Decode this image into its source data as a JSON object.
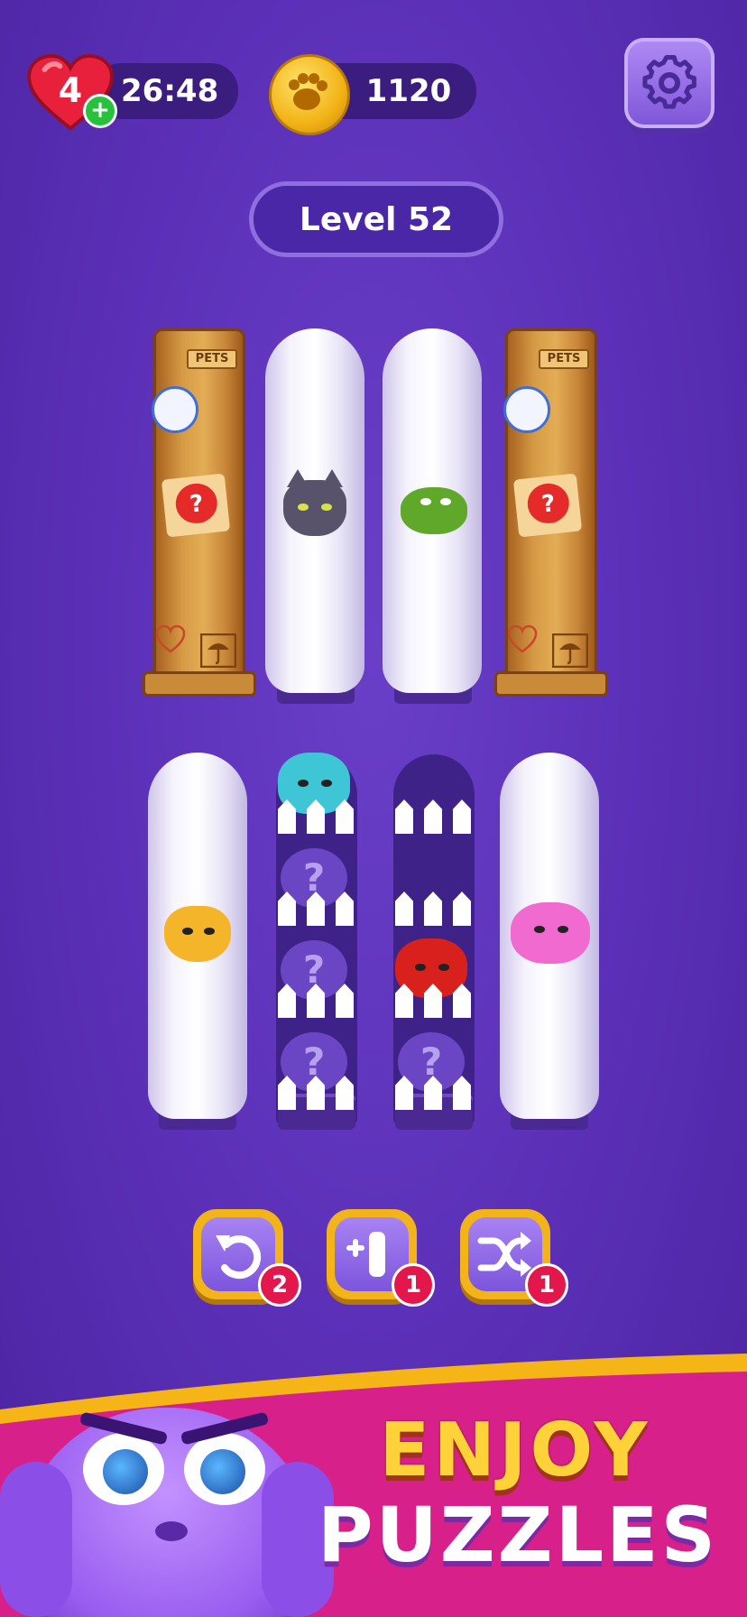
{
  "header": {
    "lives": "4",
    "lives_plus": "+",
    "timer": "26:48",
    "coins": "1120",
    "settings_icon": "gear-icon",
    "level_label": "Level 52"
  },
  "board": {
    "crate_tag": "PETS",
    "mystery_mark": "?"
  },
  "boosters": [
    {
      "name": "undo",
      "icon": "undo-icon",
      "count": "2"
    },
    {
      "name": "add-tube",
      "icon": "add-tube-icon",
      "count": "1"
    },
    {
      "name": "shuffle",
      "icon": "shuffle-icon",
      "count": "1"
    }
  ],
  "banner": {
    "line1": "ENJOY",
    "line2": "PUZZLES"
  },
  "colors": {
    "background": "#5a2fb6",
    "banner_pink": "#d8208a",
    "banner_yellow": "#f6b516",
    "badge_red": "#e4174d"
  }
}
